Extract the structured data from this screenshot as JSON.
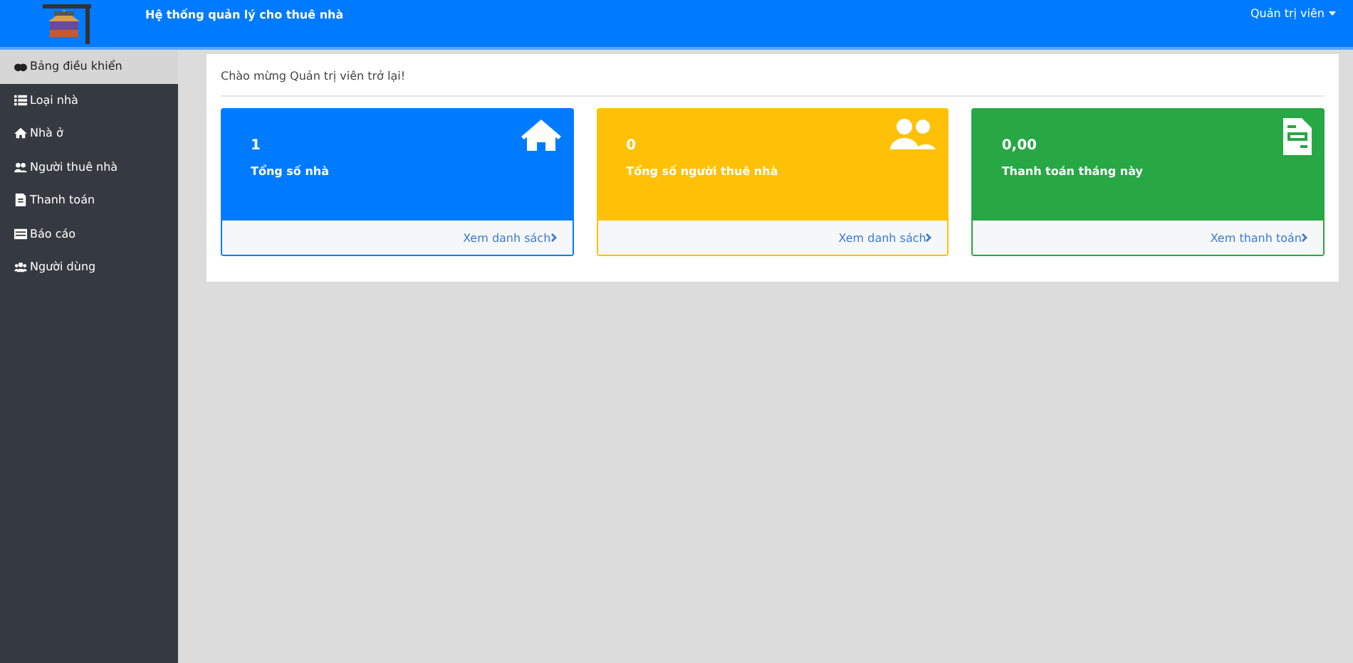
{
  "navbar": {
    "title": "Hệ thống quản lý cho thuê nhà",
    "user_menu": "Quản trị viên"
  },
  "sidebar": {
    "items": [
      {
        "label": "Bảng điều khiển",
        "selected": true
      },
      {
        "label": "Loại nhà",
        "selected": false
      },
      {
        "label": "Nhà ở",
        "selected": false
      },
      {
        "label": "Người thuê nhà",
        "selected": false
      },
      {
        "label": "Thanh toán",
        "selected": false
      },
      {
        "label": "Báo cáo",
        "selected": false
      },
      {
        "label": "Người dùng",
        "selected": false
      }
    ]
  },
  "welcome": "Chào mừng Quản trị viên trở lại!",
  "cards": [
    {
      "value": "1",
      "label": "Tổng số nhà",
      "color": "#007bff",
      "link": "Xem danh sách"
    },
    {
      "value": "0",
      "label": "Tổng số người thuê nhà",
      "color": "#ffc107",
      "link": "Xem danh sách"
    },
    {
      "value": "0,00",
      "label": "Thanh toán tháng này",
      "color": "#28a745",
      "link": "Xem thanh toán"
    }
  ]
}
